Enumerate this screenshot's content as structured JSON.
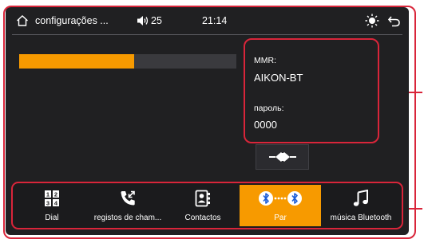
{
  "status_bar": {
    "title": "configurações ...",
    "volume": "25",
    "time": "21:14"
  },
  "pairing_progress": 0.53,
  "device_info": {
    "mmr_label": "MMR:",
    "mmr_value": "AIKON-BT",
    "password_label": "пароль:",
    "password_value": "0000"
  },
  "tabs": [
    {
      "label": "Dial",
      "icon": "dialpad-icon",
      "active": false
    },
    {
      "label": "registos de cham...",
      "icon": "call-log-icon",
      "active": false
    },
    {
      "label": "Contactos",
      "icon": "contacts-icon",
      "active": false
    },
    {
      "label": "Par",
      "icon": "bluetooth-pair-icon",
      "active": true
    },
    {
      "label": "música Bluetooth",
      "icon": "music-note-icon",
      "active": false
    }
  ],
  "colors": {
    "accent": "#f79a00",
    "highlight": "#d9253a",
    "background": "#202022"
  }
}
